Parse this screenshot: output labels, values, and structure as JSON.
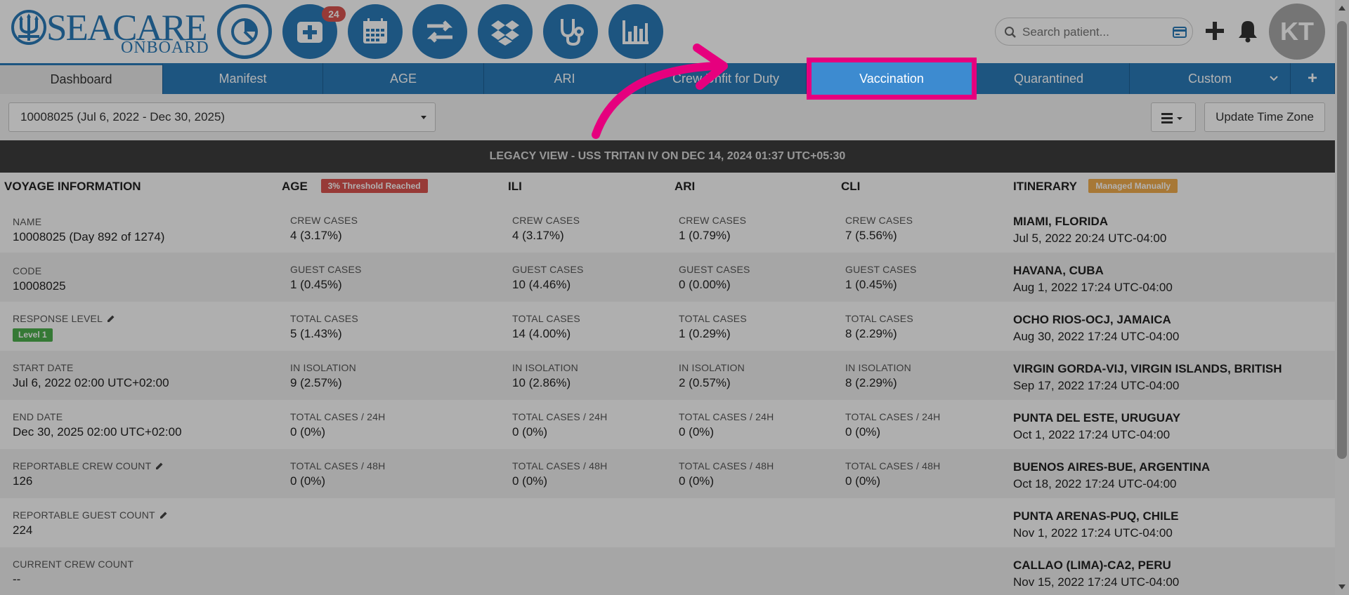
{
  "app": {
    "logo_main": "SEACARE",
    "logo_sub": "ONBOARD",
    "notification_count": "24",
    "search_placeholder": "Search patient...",
    "avatar_initials": "KT"
  },
  "nav_icons": [
    "dashboard-pie-icon",
    "medical-plus-icon",
    "calendar-icon",
    "transfer-arrows-icon",
    "dropbox-icon",
    "stethoscope-icon",
    "bar-chart-icon"
  ],
  "tabs": [
    {
      "label": "Dashboard"
    },
    {
      "label": "Manifest"
    },
    {
      "label": "AGE"
    },
    {
      "label": "ARI"
    },
    {
      "label": "Crew Unfit for Duty"
    },
    {
      "label": "Vaccination"
    },
    {
      "label": "Quarantined"
    },
    {
      "label": "Custom"
    },
    {
      "label": "+"
    }
  ],
  "filter": {
    "voyage": "10008025 (Jul 6, 2022 - Dec 30, 2025)",
    "update_tz": "Update Time Zone"
  },
  "legacy_banner": "LEGACY VIEW - USS TRITAN IV ON DEC 14, 2024 01:37 UTC+05:30",
  "sections": {
    "voyage_info": "VOYAGE INFORMATION",
    "age": "AGE",
    "age_tag": "3% Threshold Reached",
    "ili": "ILI",
    "ari": "ARI",
    "cli": "CLI",
    "itinerary": "ITINERARY",
    "itinerary_tag": "Managed Manually"
  },
  "voyage": [
    {
      "label": "NAME",
      "value": "10008025 (Day 892 of 1274)"
    },
    {
      "label": "CODE",
      "value": "10008025"
    },
    {
      "label": "RESPONSE LEVEL",
      "value": "Level 1"
    },
    {
      "label": "START DATE",
      "value": "Jul 6, 2022 02:00 UTC+02:00"
    },
    {
      "label": "END DATE",
      "value": "Dec 30, 2025 02:00 UTC+02:00"
    },
    {
      "label": "REPORTABLE CREW COUNT",
      "value": "126"
    },
    {
      "label": "REPORTABLE GUEST COUNT",
      "value": "224"
    },
    {
      "label": "CURRENT CREW COUNT",
      "value": "--"
    }
  ],
  "stat_labels": [
    "CREW CASES",
    "GUEST CASES",
    "TOTAL CASES",
    "IN ISOLATION",
    "TOTAL CASES / 24H",
    "TOTAL CASES / 48H"
  ],
  "stats": {
    "age": [
      "4 (3.17%)",
      "1 (0.45%)",
      "5 (1.43%)",
      "9 (2.57%)",
      "0 (0%)",
      "0 (0%)"
    ],
    "ili": [
      "4 (3.17%)",
      "10 (4.46%)",
      "14 (4.00%)",
      "10 (2.86%)",
      "0 (0%)",
      "0 (0%)"
    ],
    "ari": [
      "1 (0.79%)",
      "0 (0.00%)",
      "1 (0.29%)",
      "2 (0.57%)",
      "0 (0%)",
      "0 (0%)"
    ],
    "cli": [
      "7 (5.56%)",
      "1 (0.45%)",
      "8 (2.29%)",
      "8 (2.29%)",
      "0 (0%)",
      "0 (0%)"
    ]
  },
  "itinerary": [
    {
      "place": "MIAMI, FLORIDA",
      "time": "Jul 5, 2022 20:24 UTC-04:00"
    },
    {
      "place": "HAVANA, CUBA",
      "time": "Aug 1, 2022 17:24 UTC-04:00"
    },
    {
      "place": "OCHO RIOS-OCJ, JAMAICA",
      "time": "Aug 30, 2022 17:24 UTC-04:00"
    },
    {
      "place": "VIRGIN GORDA-VIJ, VIRGIN ISLANDS, BRITISH",
      "time": "Sep 17, 2022 17:24 UTC-04:00"
    },
    {
      "place": "PUNTA DEL ESTE, URUGUAY",
      "time": "Oct 1, 2022 17:24 UTC-04:00"
    },
    {
      "place": "BUENOS AIRES-BUE, ARGENTINA",
      "time": "Oct 18, 2022 17:24 UTC-04:00"
    },
    {
      "place": "PUNTA ARENAS-PUQ, CHILE",
      "time": "Nov 1, 2022 17:24 UTC-04:00"
    },
    {
      "place": "CALLAO (LIMA)-CA2, PERU",
      "time": "Nov 15, 2022 17:24 UTC-04:00"
    }
  ],
  "colors": {
    "brand": "#2a7ab8",
    "highlight": "#e6007e",
    "threshold_tag": "#d9534f",
    "managed_tag": "#f0ad4e",
    "level_badge": "#4cae4c"
  }
}
